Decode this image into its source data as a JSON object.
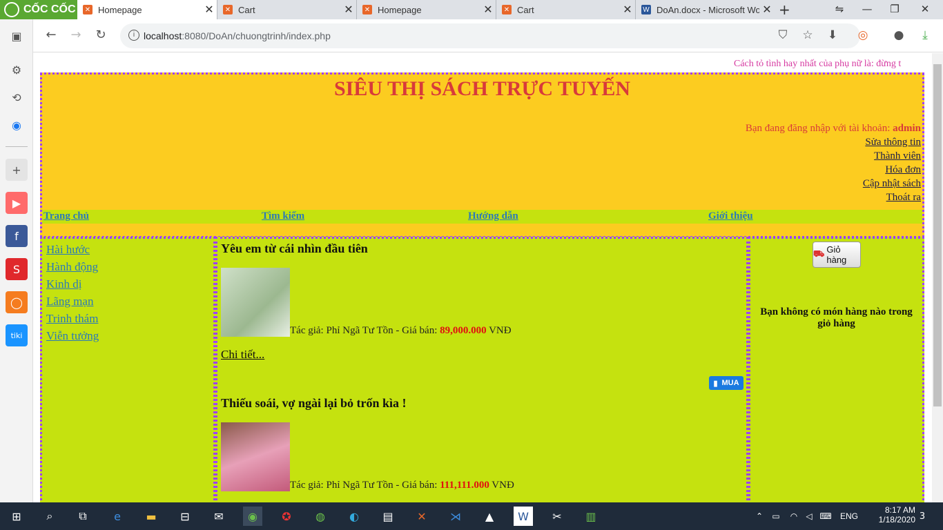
{
  "browser": {
    "brand": "CỐC CỐC",
    "tabs": [
      {
        "label": "Homepage",
        "icon": "xampp-icon",
        "active": true
      },
      {
        "label": "Cart",
        "icon": "xampp-icon",
        "active": false
      },
      {
        "label": "Homepage",
        "icon": "xampp-icon",
        "active": false
      },
      {
        "label": "Cart",
        "icon": "xampp-icon",
        "active": false
      },
      {
        "label": "DoAn.docx - Microsoft Wor",
        "icon": "word-icon",
        "active": false
      }
    ],
    "url_host": "localhost",
    "url_path": ":8080/DoAn/chuongtrinh/index.php"
  },
  "site": {
    "marquee": "Cách tỏ tình hay nhất của phụ nữ là: đừng t",
    "title": "SIÊU THỊ SÁCH TRỰC TUYẾN",
    "login_text": "Bạn đang đăng nhập với tài khoản: ",
    "login_user": "admin",
    "account_links": [
      "Sửa thông tin",
      "Thành viên",
      "Hóa đơn",
      "Cập nhật sách",
      "Thoát ra"
    ],
    "menu": [
      "Trang chủ",
      "Tìm kiếm",
      "Hướng dẫn",
      "Giới thiệu"
    ],
    "categories": [
      "Hài hước",
      "Hành động",
      "Kinh dị",
      "Lãng mạn",
      "Trinh thám",
      "Viễn tưởng"
    ],
    "books": [
      {
        "title": "Yêu em từ cái nhìn đầu tiên",
        "author_prefix": "Tác giả: Phỉ Ngã Tư Tồn - Giá bán: ",
        "price": "89,000.000",
        "currency": " VNĐ",
        "detail": "Chi tiết...",
        "buy": "MUA"
      },
      {
        "title": "Thiếu soái, vợ ngài lại bỏ trốn kìa !",
        "author_prefix": "Tác giả: Phỉ Ngã Tư Tồn - Giá bán: ",
        "price": "111,111.000",
        "currency": " VNĐ"
      }
    ],
    "cart_button": "Giỏ hàng",
    "cart_empty": "Bạn không có món hàng nào trong giỏ hàng"
  },
  "taskbar": {
    "time": "8:17 AM",
    "date": "1/18/2020",
    "lang": "ENG",
    "notifications": "3"
  },
  "colors": {
    "header_bg": "#fccc20",
    "panel_bg": "#c5e20f",
    "title": "#d83a3a",
    "border": "#a040ff"
  }
}
